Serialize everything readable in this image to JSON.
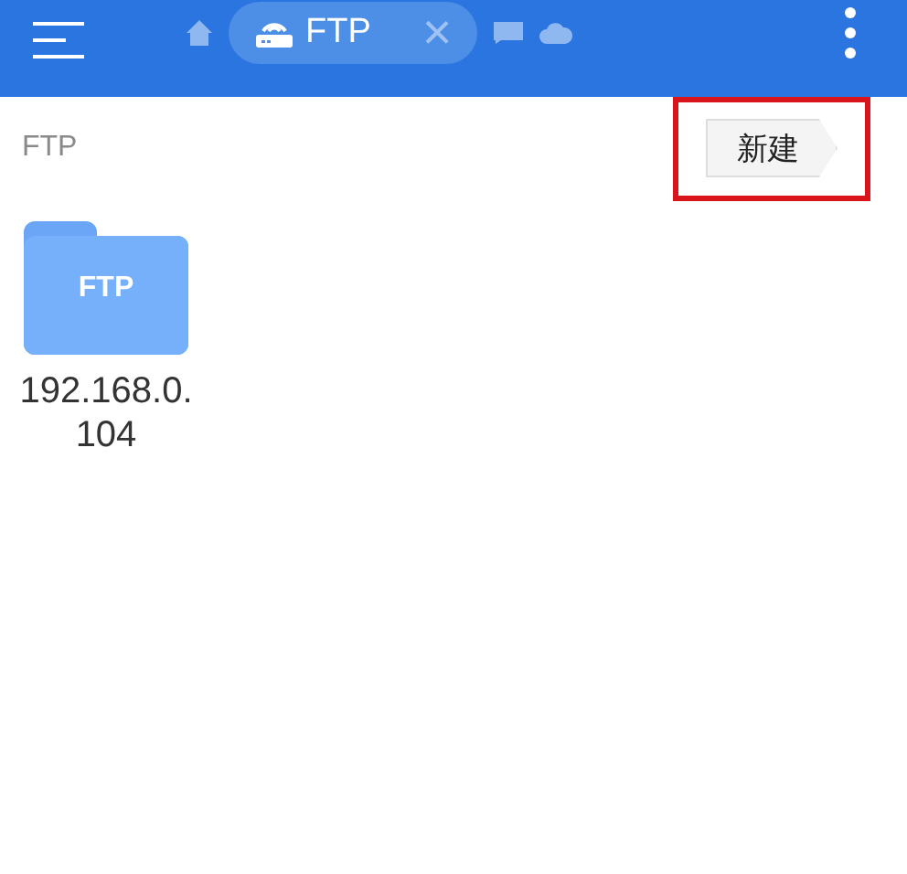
{
  "toolbar": {
    "tabs": [
      {
        "kind": "home",
        "selected": false
      },
      {
        "kind": "ftp",
        "label": "FTP",
        "close": "×",
        "selected": true
      },
      {
        "kind": "window",
        "selected": false
      },
      {
        "kind": "cloud",
        "selected": false
      }
    ]
  },
  "path": "FTP",
  "new_button": {
    "label": "新建",
    "highlighted": true
  },
  "items": [
    {
      "folder_label": "FTP",
      "name": "192.168.0.104"
    }
  ]
}
